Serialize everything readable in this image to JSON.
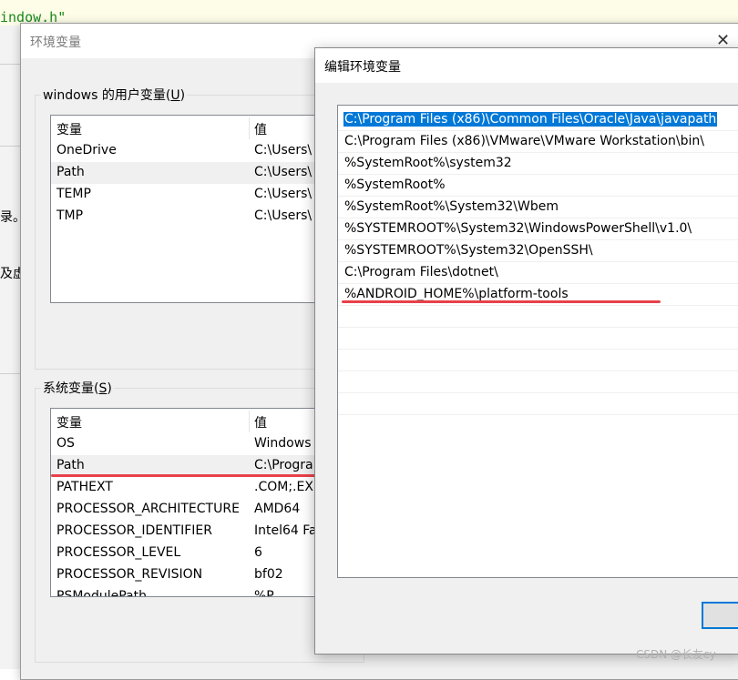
{
  "background": {
    "code_fragment": "indow.h\"",
    "left_fragments": [
      "录。",
      "及虚"
    ]
  },
  "env_dialog": {
    "title": "环境变量",
    "close_symbol": "✕",
    "user_group": {
      "label": "windows 的用户变量(",
      "accesskey": "U",
      "label_end": ")",
      "headers": [
        "变量",
        "值"
      ],
      "rows": [
        {
          "name": "OneDrive",
          "value": "C:\\Users\\"
        },
        {
          "name": "Path",
          "value": "C:\\Users\\"
        },
        {
          "name": "TEMP",
          "value": "C:\\Users\\"
        },
        {
          "name": "TMP",
          "value": "C:\\Users\\"
        }
      ]
    },
    "system_group": {
      "label": "系统变量(",
      "accesskey": "S",
      "label_end": ")",
      "headers": [
        "变量",
        "值"
      ],
      "rows": [
        {
          "name": "OS",
          "value": "Windows"
        },
        {
          "name": "Path",
          "value": "C:\\Progra"
        },
        {
          "name": "PATHEXT",
          "value": ".COM;.EX"
        },
        {
          "name": "PROCESSOR_ARCHITECTURE",
          "value": "AMD64"
        },
        {
          "name": "PROCESSOR_IDENTIFIER",
          "value": "Intel64 Fa"
        },
        {
          "name": "PROCESSOR_LEVEL",
          "value": "6"
        },
        {
          "name": "PROCESSOR_REVISION",
          "value": "bf02"
        },
        {
          "name": "PSModulePath",
          "value": "%P"
        }
      ]
    }
  },
  "edit_dialog": {
    "title": "编辑环境变量",
    "entries": [
      "C:\\Program Files (x86)\\Common Files\\Oracle\\Java\\javapath",
      "C:\\Program Files (x86)\\VMware\\VMware Workstation\\bin\\",
      "%SystemRoot%\\system32",
      "%SystemRoot%",
      "%SystemRoot%\\System32\\Wbem",
      "%SYSTEMROOT%\\System32\\WindowsPowerShell\\v1.0\\",
      "%SYSTEMROOT%\\System32\\OpenSSH\\",
      "C:\\Program Files\\dotnet\\",
      "%ANDROID_HOME%\\platform-tools"
    ],
    "selected_index": 0
  },
  "watermark": "CSDN @长友cy",
  "colors": {
    "selection": "#0078d7",
    "annotation": "#e8414a"
  }
}
